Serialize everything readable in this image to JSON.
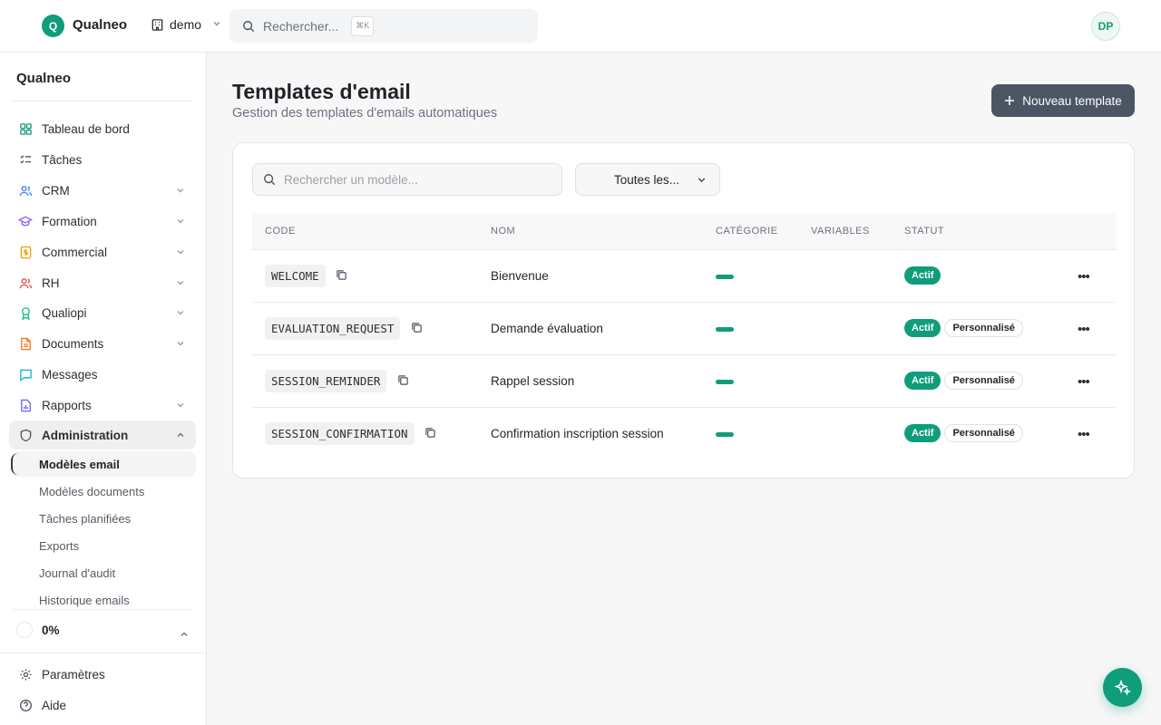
{
  "header": {
    "logo_letter": "Q",
    "brand": "Qualneo",
    "org": "demo",
    "search_placeholder": "Rechercher...",
    "search_shortcut": "⌘K",
    "avatar_initials": "DP"
  },
  "sidebar": {
    "title": "Qualneo",
    "items": [
      {
        "label": "Tableau de bord",
        "icon": "dashboard-icon",
        "color": "#0f9d7a"
      },
      {
        "label": "Tâches",
        "icon": "tasks-list-icon",
        "color": "#4b5563"
      },
      {
        "label": "CRM",
        "icon": "users-icon",
        "color": "#3b82f6"
      },
      {
        "label": "Formation",
        "icon": "graduation-cap-icon",
        "color": "#8b5cf6"
      },
      {
        "label": "Commercial",
        "icon": "dollar-file-icon",
        "color": "#f59e0b"
      },
      {
        "label": "RH",
        "icon": "team-icon",
        "color": "#ef4444"
      },
      {
        "label": "Qualiopi",
        "icon": "award-icon",
        "color": "#10b981"
      },
      {
        "label": "Documents",
        "icon": "document-icon",
        "color": "#f97316"
      },
      {
        "label": "Messages",
        "icon": "message-icon",
        "color": "#06b6d4"
      },
      {
        "label": "Rapports",
        "icon": "report-icon",
        "color": "#6366f1"
      },
      {
        "label": "Administration",
        "icon": "shield-icon",
        "color": "#4b5563"
      }
    ],
    "sub_items": [
      "Modèles email",
      "Modèles documents",
      "Tâches planifiées",
      "Exports",
      "Journal d'audit",
      "Historique emails"
    ],
    "progress_label": "0%",
    "footer": [
      {
        "label": "Paramètres",
        "icon": "gear-icon"
      },
      {
        "label": "Aide",
        "icon": "help-icon"
      }
    ]
  },
  "main": {
    "title": "Templates d'email",
    "subtitle": "Gestion des templates d'emails automatiques",
    "new_button": "Nouveau template",
    "search_placeholder": "Rechercher un modèle...",
    "filter_value": "Toutes les...",
    "columns": [
      "CODE",
      "NOM",
      "CATÉGORIE",
      "VARIABLES",
      "STATUT"
    ],
    "rows": [
      {
        "code": "WELCOME",
        "nom": "Bienvenue",
        "statut": "Actif",
        "perso": ""
      },
      {
        "code": "EVALUATION_REQUEST",
        "nom": "Demande évaluation",
        "statut": "Actif",
        "perso": "Personnalisé"
      },
      {
        "code": "SESSION_REMINDER",
        "nom": "Rappel session",
        "statut": "Actif",
        "perso": "Personnalisé"
      },
      {
        "code": "SESSION_CONFIRMATION",
        "nom": "Confirmation inscription session",
        "statut": "Actif",
        "perso": "Personnalisé"
      }
    ],
    "accent_color": "#0f9d7a"
  }
}
